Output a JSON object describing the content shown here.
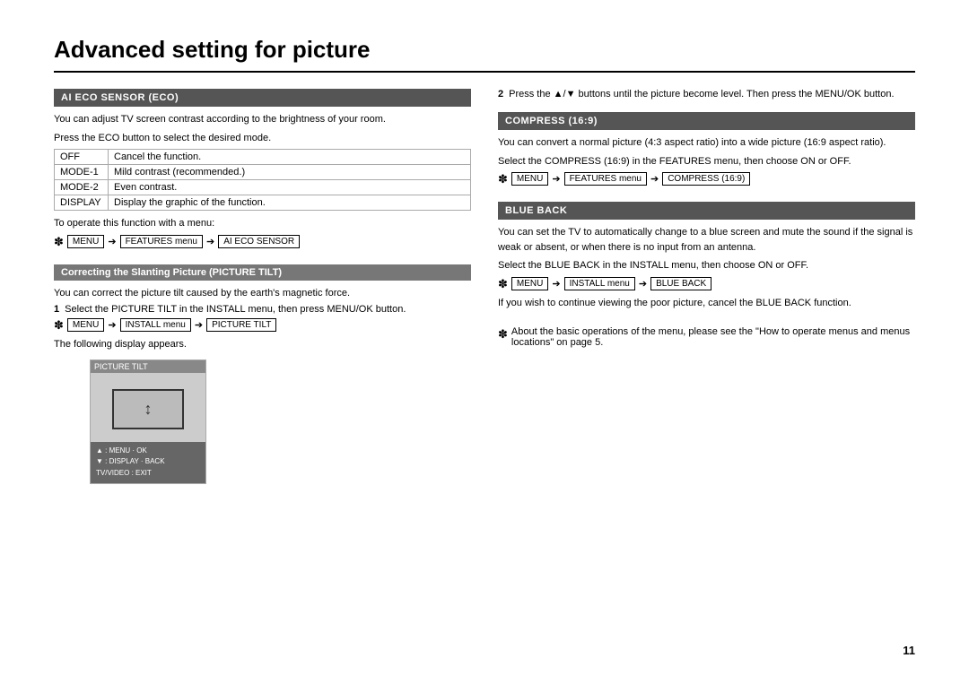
{
  "page": {
    "title": "Advanced setting for picture",
    "page_number": "11"
  },
  "left_column": {
    "section1": {
      "header": "AI ECO SENSOR (ECO)",
      "para1": "You can adjust TV screen contrast according to the brightness of your room.",
      "para2": "Press the ECO button to select the desired mode.",
      "table": [
        {
          "mode": "OFF",
          "description": "Cancel the function."
        },
        {
          "mode": "MODE-1",
          "description": "Mild contrast (recommended.)"
        },
        {
          "mode": "MODE-2",
          "description": "Even contrast."
        },
        {
          "mode": "DISPLAY",
          "description": "Display the graphic of the function."
        }
      ],
      "menu_label": "To operate this function with a menu:",
      "menu_path": {
        "asterisk": "✽",
        "items": [
          "MENU",
          "FEATURES menu",
          "AI ECO SENSOR"
        ]
      }
    },
    "section2": {
      "header": "Correcting the Slanting Picture (PICTURE TILT)",
      "para1": "You can correct the picture tilt caused by the earth's magnetic force.",
      "step1_num": "1",
      "step1_text": "Select the PICTURE TILT in the INSTALL menu, then press MENU/OK button.",
      "menu_path": {
        "asterisk": "✽",
        "items": [
          "MENU",
          "INSTALL menu",
          "PICTURE TILT"
        ]
      },
      "following": "The following display appears.",
      "diagram": {
        "title": "PICTURE TILT",
        "controls": [
          "▲ : MENU · OK",
          "▼ : DISPLAY · BACK",
          "TV/VIDEO : EXIT"
        ]
      }
    }
  },
  "right_column": {
    "step2_intro": "Press the ▲/▼ buttons until the picture become level. Then press the MENU/OK button.",
    "step2_num": "2",
    "section3": {
      "header": "COMPRESS (16:9)",
      "para1": "You can convert a normal picture (4:3 aspect ratio) into a wide picture (16:9 aspect ratio).",
      "para2": "Select the COMPRESS (16:9) in the FEATURES menu, then choose ON or OFF.",
      "menu_path": {
        "asterisk": "✽",
        "items": [
          "MENU",
          "FEATURES menu",
          "COMPRESS (16:9)"
        ]
      }
    },
    "section4": {
      "header": "BLUE BACK",
      "para1": "You can set the TV to automatically change to a blue screen and mute the sound if the signal is weak or absent, or when there is no input from an antenna.",
      "para2": "Select the BLUE BACK in the INSTALL menu, then choose ON or OFF.",
      "menu_path": {
        "asterisk": "✽",
        "items": [
          "MENU",
          "INSTALL menu",
          "BLUE BACK"
        ]
      },
      "para3": "If you wish to continue viewing the poor picture, cancel the BLUE BACK function."
    },
    "note": {
      "asterisk": "✽",
      "text": "About the basic operations of the menu, please see the \"How to operate menus and menus locations\" on page 5."
    }
  }
}
